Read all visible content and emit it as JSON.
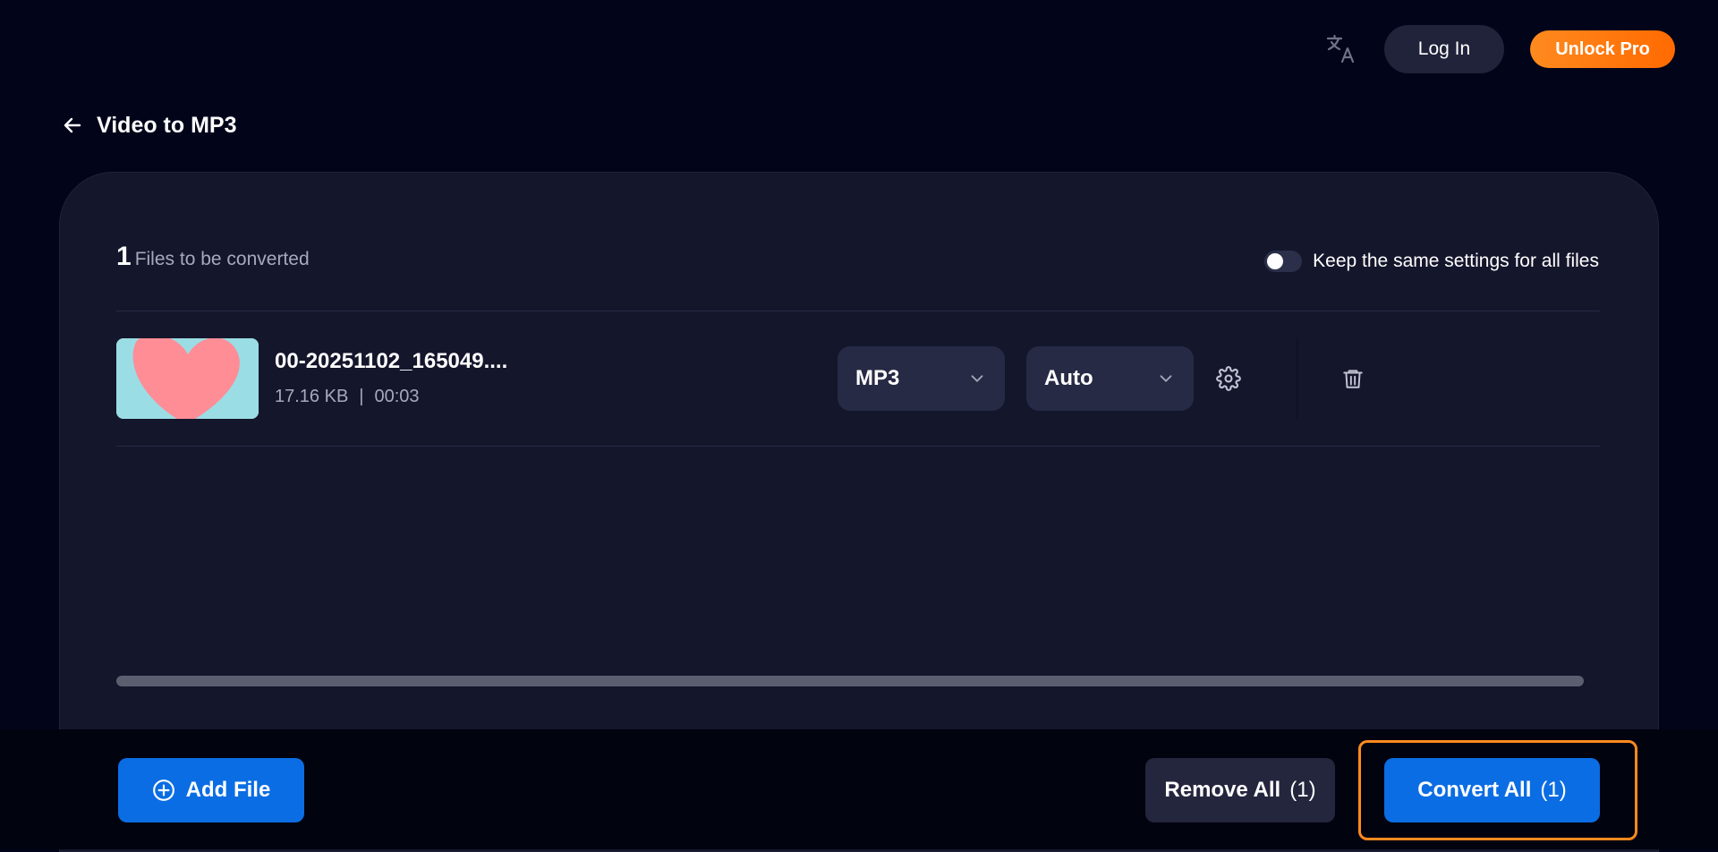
{
  "header": {
    "login_label": "Log In",
    "unlock_label": "Unlock Pro"
  },
  "page": {
    "title": "Video to MP3"
  },
  "files_header": {
    "count": "1",
    "label": "Files to be converted",
    "keep_settings_label": "Keep the same settings for all files",
    "keep_settings_on": false
  },
  "files": [
    {
      "name": "00-20251102_165049....",
      "size": "17.16 KB",
      "separator": "|",
      "duration": "00:03",
      "format": "MP3",
      "quality": "Auto"
    }
  ],
  "footer": {
    "add_label": "Add File",
    "remove_label": "Remove All",
    "remove_count": "(1)",
    "convert_label": "Convert All",
    "convert_count": "(1)"
  },
  "colors": {
    "background": "#02041a",
    "card": "#14162c",
    "primary": "#0b6de3",
    "accent": "#ff8a1f"
  },
  "icons": {
    "translate": "translate-icon",
    "back": "arrow-left-icon",
    "settings": "gear-icon",
    "delete": "trash-icon",
    "add": "plus-circle-icon",
    "dropdown": "chevron-down-icon"
  }
}
